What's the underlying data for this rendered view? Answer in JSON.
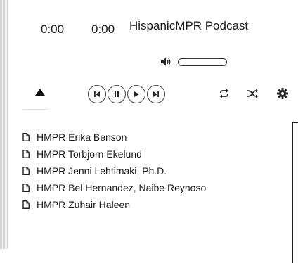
{
  "player": {
    "current_time": "0:00",
    "duration": "0:00",
    "title": "HispanicMPR Podcast",
    "volume_level": 0,
    "icons": {
      "volume": "speaker-icon",
      "collapse": "triangle-up-icon",
      "previous": "skip-previous-icon",
      "pause": "pause-icon",
      "play": "play-icon",
      "next": "skip-next-icon",
      "repeat": "repeat-icon",
      "shuffle": "shuffle-icon",
      "settings": "gear-icon",
      "track": "document-icon"
    }
  },
  "playlist": {
    "tracks": [
      {
        "label": "HMPR Erika Benson"
      },
      {
        "label": "HMPR Torbjorn Ekelund"
      },
      {
        "label": "HMPR Jenni Lehtimaki, Ph.D."
      },
      {
        "label": "HMPR Bel Hernandez, Naibe Reynoso"
      },
      {
        "label": "HMPR Zuhair Haleen"
      }
    ]
  }
}
